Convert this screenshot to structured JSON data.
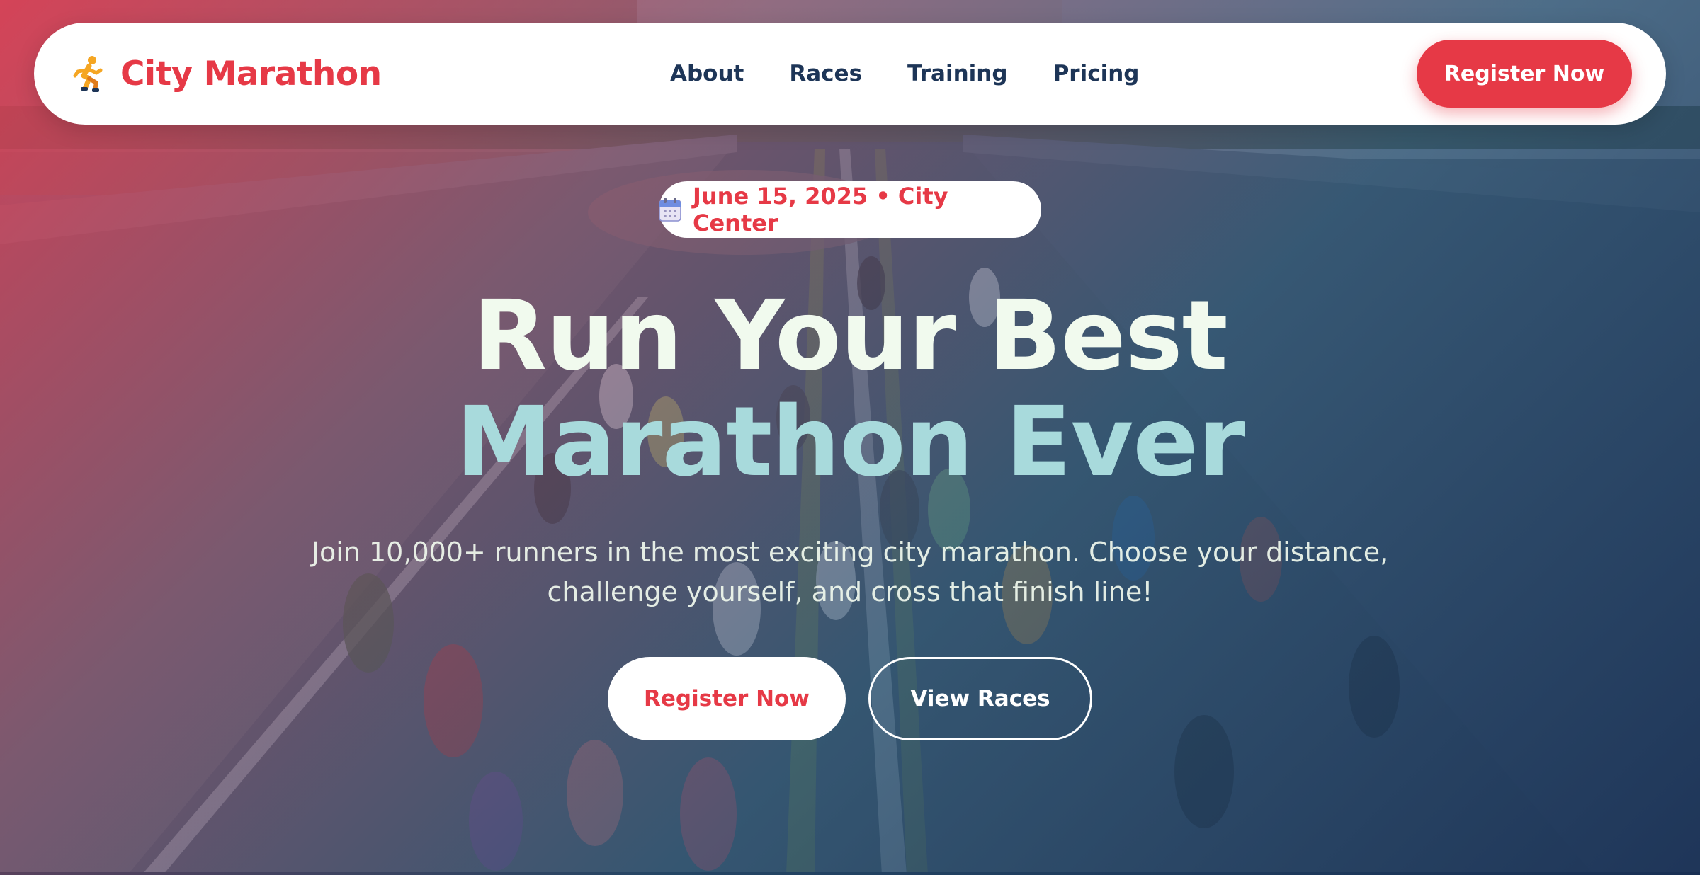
{
  "brand": {
    "name": "City Marathon",
    "icon": "runner-icon"
  },
  "nav": {
    "links": [
      {
        "label": "About"
      },
      {
        "label": "Races"
      },
      {
        "label": "Training"
      },
      {
        "label": "Pricing"
      }
    ],
    "cta_label": "Register Now"
  },
  "hero": {
    "badge": {
      "icon": "calendar-icon",
      "text": "June 15, 2025 • City Center"
    },
    "headline_line1": "Run Your Best",
    "headline_line2": "Marathon Ever",
    "subtitle": "Join 10,000+ runners in the most exciting city marathon. Choose your distance, challenge yourself, and cross that finish line!",
    "primary_cta": "Register Now",
    "secondary_cta": "View Races",
    "background": "marathon-runners-street-photo"
  },
  "colors": {
    "accent": "#e63946",
    "navy": "#1d3557",
    "headline_light": "#f1faee",
    "headline_teal": "#a8dadc"
  }
}
